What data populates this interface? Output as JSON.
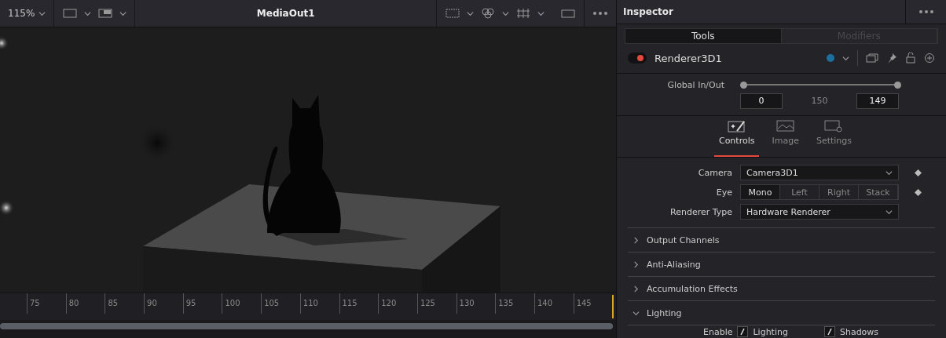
{
  "viewer": {
    "zoom": "115%",
    "title": "MediaOut1",
    "ruler": [
      "75",
      "80",
      "85",
      "90",
      "95",
      "100",
      "105",
      "110",
      "115",
      "120",
      "125",
      "130",
      "135",
      "140",
      "145"
    ]
  },
  "inspector": {
    "title": "Inspector",
    "tabs": [
      {
        "label": "Tools",
        "selected": true
      },
      {
        "label": "Modifiers",
        "selected": false
      }
    ],
    "node": {
      "name": "Renderer3D1",
      "enabled": true
    },
    "global_in_out": {
      "label": "Global In/Out",
      "in": "0",
      "duration": "150",
      "out": "149",
      "range": [
        {
          "level": 0
        },
        {
          "level": 1
        }
      ]
    },
    "panel_tabs": [
      {
        "label": "Controls",
        "kind": "controls",
        "selected": true
      },
      {
        "label": "Image",
        "kind": "image",
        "selected": false
      },
      {
        "label": "Settings",
        "kind": "settings",
        "selected": false
      }
    ],
    "camera": {
      "label": "Camera",
      "value": "Camera3D1"
    },
    "eye": {
      "label": "Eye",
      "options": [
        {
          "label": "Mono",
          "selected": true
        },
        {
          "label": "Left",
          "selected": false
        },
        {
          "label": "Right",
          "selected": false
        },
        {
          "label": "Stack",
          "selected": false
        }
      ]
    },
    "renderer_type": {
      "label": "Renderer Type",
      "value": "Hardware Renderer"
    },
    "sections": [
      {
        "label": "Output Channels",
        "expanded": false
      },
      {
        "label": "Anti-Aliasing",
        "expanded": false
      },
      {
        "label": "Accumulation Effects",
        "expanded": false
      },
      {
        "label": "Lighting",
        "expanded": true
      }
    ],
    "lighting": {
      "label": "Enable",
      "checkboxes": [
        {
          "label": "Lighting",
          "checked": true
        },
        {
          "label": "Shadows",
          "checked": true
        }
      ]
    }
  }
}
